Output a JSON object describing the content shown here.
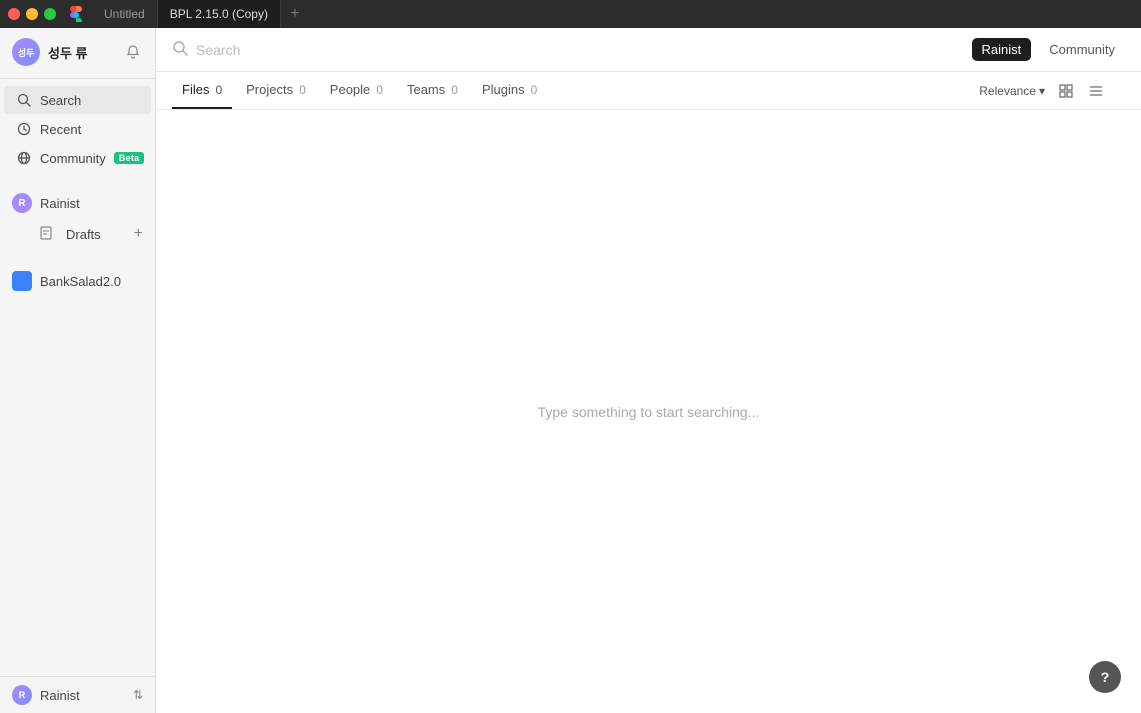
{
  "titlebar": {
    "tabs": [
      {
        "id": "untitled",
        "label": "Untitled",
        "active": false
      },
      {
        "id": "bpl",
        "label": "BPL 2.15.0 (Copy)",
        "active": true
      }
    ],
    "add_tab_label": "+"
  },
  "sidebar": {
    "user": {
      "name": "성두 류",
      "avatar_initials": "성두"
    },
    "nav": [
      {
        "id": "search",
        "label": "Search",
        "icon": "🔍",
        "active": true
      },
      {
        "id": "recent",
        "label": "Recent",
        "icon": "🕐",
        "active": false
      },
      {
        "id": "community",
        "label": "Community",
        "icon": "🌐",
        "active": false,
        "badge": "Beta"
      }
    ],
    "personal": {
      "label": "Rainist",
      "avatar_initials": "R",
      "avatar_color": "#a78bfa",
      "drafts_label": "Drafts"
    },
    "teams": [
      {
        "id": "banksalad",
        "label": "BankSalad2.0",
        "color": "#3b82f6"
      }
    ],
    "bottom": {
      "name": "Rainist",
      "avatar_initials": "R",
      "avatar_color": "#a78bfa"
    }
  },
  "search": {
    "placeholder": "Search",
    "scope_rainist": "Rainist",
    "scope_community": "Community"
  },
  "filters": [
    {
      "id": "files",
      "label": "Files",
      "count": "0",
      "active": true
    },
    {
      "id": "projects",
      "label": "Projects",
      "count": "0",
      "active": false
    },
    {
      "id": "people",
      "label": "People",
      "count": "0",
      "active": false
    },
    {
      "id": "teams",
      "label": "Teams",
      "count": "0",
      "active": false
    },
    {
      "id": "plugins",
      "label": "Plugins",
      "count": "0",
      "active": false
    }
  ],
  "sort": {
    "label": "Relevance",
    "chevron": "▾"
  },
  "empty_state": {
    "message": "Type something to start searching..."
  },
  "help": {
    "label": "?"
  }
}
